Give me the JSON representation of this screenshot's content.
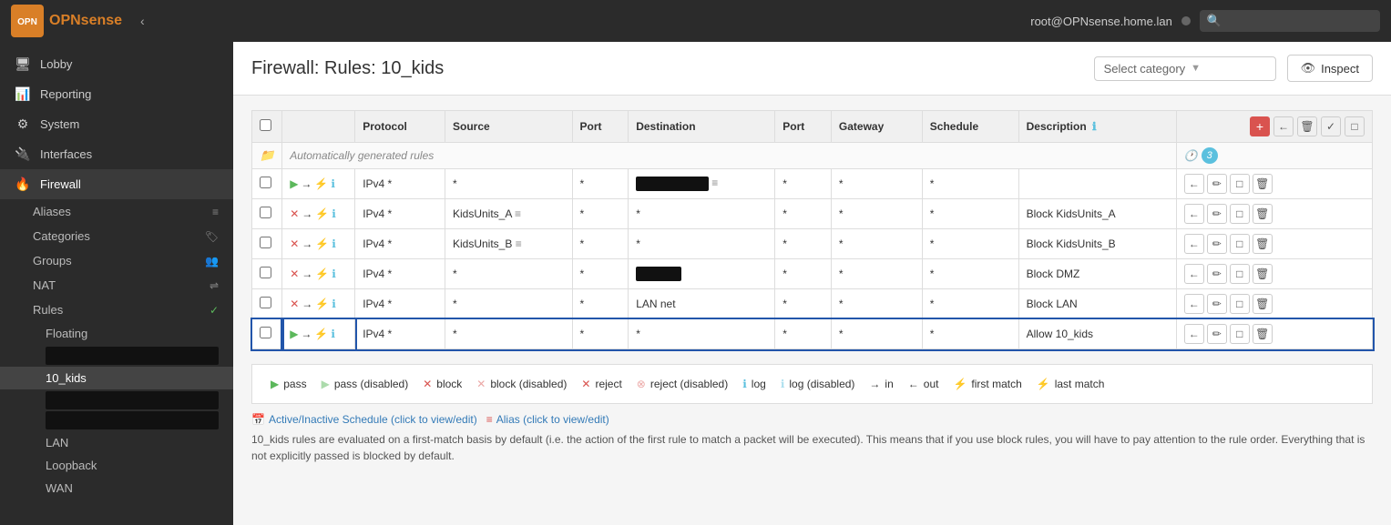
{
  "navbar": {
    "brand": "OPN",
    "brand_suffix": "sense",
    "user": "root@OPNsense.home.lan",
    "search_placeholder": ""
  },
  "sidebar": {
    "items": [
      {
        "id": "lobby",
        "label": "Lobby",
        "icon": "🖥"
      },
      {
        "id": "reporting",
        "label": "Reporting",
        "icon": "📊"
      },
      {
        "id": "system",
        "label": "System",
        "icon": "⚙"
      },
      {
        "id": "interfaces",
        "label": "Interfaces",
        "icon": "🔌"
      },
      {
        "id": "firewall",
        "label": "Firewall",
        "icon": "🔥",
        "active": true
      }
    ],
    "firewall_sub": [
      {
        "id": "aliases",
        "label": "Aliases",
        "icon": "≡"
      },
      {
        "id": "categories",
        "label": "Categories",
        "icon": "🏷"
      },
      {
        "id": "groups",
        "label": "Groups",
        "icon": "👥"
      },
      {
        "id": "nat",
        "label": "NAT",
        "icon": "⇌"
      },
      {
        "id": "rules",
        "label": "Rules",
        "icon": "✓"
      }
    ],
    "rules_sub": [
      {
        "id": "floating",
        "label": "Floating"
      },
      {
        "id": "rule1",
        "label": "",
        "black": true
      },
      {
        "id": "10_kids",
        "label": "10_kids",
        "active": true
      },
      {
        "id": "rule2",
        "label": "",
        "black": true
      },
      {
        "id": "rule3",
        "label": "",
        "black": true
      },
      {
        "id": "lan",
        "label": "LAN"
      },
      {
        "id": "loopback",
        "label": "Loopback"
      },
      {
        "id": "wan",
        "label": "WAN"
      }
    ]
  },
  "main": {
    "title": "Firewall: Rules: 10_kids",
    "category_placeholder": "Select category",
    "inspect_label": "Inspect"
  },
  "table": {
    "headers": {
      "protocol": "Protocol",
      "source": "Source",
      "port": "Port",
      "destination": "Destination",
      "dest_port": "Port",
      "gateway": "Gateway",
      "schedule": "Schedule",
      "description": "Description"
    },
    "auto_gen_text": "Automatically generated rules",
    "badge_count": "3",
    "rows": [
      {
        "id": "row1",
        "action": "pass",
        "action_color": "green",
        "protocol": "IPv4 *",
        "source": "*",
        "port": "*",
        "destination": "BLACK_BOX",
        "dest_port": "*",
        "gateway": "*",
        "schedule": "*",
        "description": ""
      },
      {
        "id": "row2",
        "action": "block",
        "action_color": "red",
        "protocol": "IPv4 *",
        "source": "KidsUnits_A",
        "port": "*",
        "destination": "*",
        "dest_port": "*",
        "gateway": "*",
        "schedule": "*",
        "description": "Block KidsUnits_A"
      },
      {
        "id": "row3",
        "action": "block",
        "action_color": "red",
        "protocol": "IPv4 *",
        "source": "KidsUnits_B",
        "port": "*",
        "destination": "*",
        "dest_port": "*",
        "gateway": "*",
        "schedule": "*",
        "description": "Block KidsUnits_B"
      },
      {
        "id": "row4",
        "action": "block",
        "action_color": "red",
        "protocol": "IPv4 *",
        "source": "*",
        "port": "*",
        "destination": "BLACK_BOX_SM",
        "dest_port": "*",
        "gateway": "*",
        "schedule": "*",
        "description": "Block DMZ"
      },
      {
        "id": "row5",
        "action": "block",
        "action_color": "red",
        "protocol": "IPv4 *",
        "source": "*",
        "port": "*",
        "destination": "LAN net",
        "dest_port": "*",
        "gateway": "*",
        "schedule": "*",
        "description": "Block LAN"
      },
      {
        "id": "row6",
        "action": "pass",
        "action_color": "green",
        "protocol": "IPv4 *",
        "source": "*",
        "port": "*",
        "destination": "*",
        "dest_port": "*",
        "gateway": "*",
        "schedule": "*",
        "description": "Allow 10_kids",
        "highlighted": true
      }
    ]
  },
  "legend": {
    "items": [
      {
        "symbol": "▶",
        "color": "#5cb85c",
        "label": "pass"
      },
      {
        "symbol": "▶",
        "color": "#5cb85c",
        "label": "pass (disabled)"
      },
      {
        "symbol": "✕",
        "color": "#d9534f",
        "label": "block"
      },
      {
        "symbol": "✕",
        "color": "#d9534f",
        "label": "block (disabled)"
      },
      {
        "symbol": "✕",
        "color": "#d9534f",
        "label": "reject"
      },
      {
        "symbol": "⊗",
        "color": "#d9534f",
        "label": "reject (disabled)"
      },
      {
        "symbol": "ℹ",
        "color": "#5bc0de",
        "label": "log"
      },
      {
        "symbol": "ℹ",
        "color": "#5bc0de",
        "label": "log (disabled)"
      },
      {
        "symbol": "→",
        "color": "#333",
        "label": "in"
      },
      {
        "symbol": "←",
        "color": "#333",
        "label": "out"
      },
      {
        "symbol": "⚡",
        "color": "#f0ad4e",
        "label": "first match"
      },
      {
        "symbol": "⚡",
        "color": "#f0ad4e",
        "label": "last match"
      }
    ]
  },
  "notes": {
    "schedule_link": "Active/Inactive Schedule (click to view/edit)",
    "alias_link": "Alias (click to view/edit)",
    "description_text": "10_kids rules are evaluated on a first-match basis by default (i.e. the action of the first rule to match a packet will be executed). This means that if you use block rules, you will have to pay attention to the rule order. Everything that is not explicitly passed is blocked by default."
  }
}
